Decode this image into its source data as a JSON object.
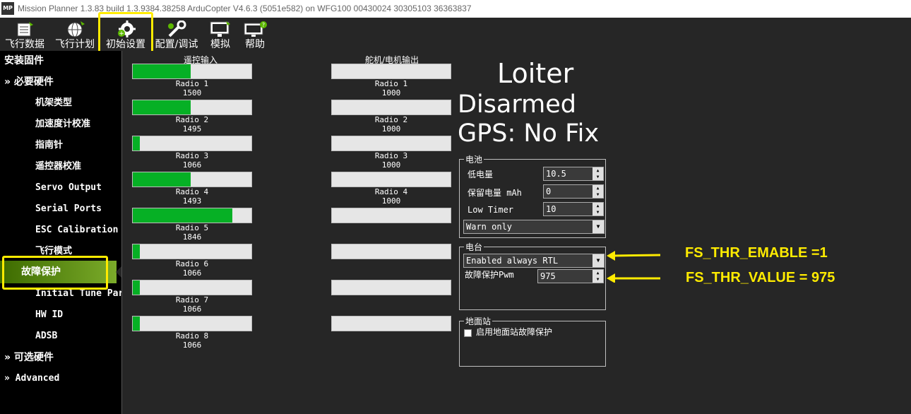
{
  "window": {
    "logo_text": "MP",
    "title": "Mission Planner 1.3.83 build 1.3.9384.38258 ArduCopter V4.6.3 (5051e582) on WFG100 00430024 30305103 36363837"
  },
  "toolbar": {
    "items": [
      {
        "label": "飞行数据",
        "icon": "flight-data-icon"
      },
      {
        "label": "飞行计划",
        "icon": "flight-plan-globe-icon"
      },
      {
        "label": "初始设置",
        "icon": "initial-setup-gear-icon"
      },
      {
        "label": "配置/调试",
        "icon": "config-tuning-wrench-icon"
      },
      {
        "label": "模拟",
        "icon": "simulation-monitor-icon"
      },
      {
        "label": "帮助",
        "icon": "help-monitor-icon"
      }
    ],
    "highlight_color": "#ffeb00"
  },
  "sidebar": {
    "items": [
      {
        "label": "安装固件"
      },
      {
        "label": "» 必要硬件"
      },
      {
        "label": "机架类型"
      },
      {
        "label": "加速度计校准"
      },
      {
        "label": "指南针"
      },
      {
        "label": "遥控器校准"
      },
      {
        "label": "Servo Output"
      },
      {
        "label": "Serial Ports"
      },
      {
        "label": "ESC Calibration"
      },
      {
        "label": "飞行模式"
      },
      {
        "label": "故障保护"
      },
      {
        "label": "Initial Tune Para"
      },
      {
        "label": "HW ID"
      },
      {
        "label": "ADSB"
      },
      {
        "label": "» 可选硬件"
      },
      {
        "label": "» Advanced"
      }
    ],
    "selected_color": "#7bab2a"
  },
  "rc_input": {
    "title": "遥控输入",
    "channels": [
      {
        "name": "Radio 1",
        "value": "1500",
        "fill": 0.49
      },
      {
        "name": "Radio 2",
        "value": "1495",
        "fill": 0.49
      },
      {
        "name": "Radio 3",
        "value": "1066",
        "fill": 0.06
      },
      {
        "name": "Radio 4",
        "value": "1493",
        "fill": 0.49
      },
      {
        "name": "Radio 5",
        "value": "1846",
        "fill": 0.84
      },
      {
        "name": "Radio 6",
        "value": "1066",
        "fill": 0.06
      },
      {
        "name": "Radio 7",
        "value": "1066",
        "fill": 0.06
      },
      {
        "name": "Radio 8",
        "value": "1066",
        "fill": 0.06
      }
    ]
  },
  "servo_output": {
    "title": "舵机/电机输出",
    "channels": [
      {
        "name": "Radio 1",
        "value": "1000",
        "fill": 0
      },
      {
        "name": "Radio 2",
        "value": "1000",
        "fill": 0
      },
      {
        "name": "Radio 3",
        "value": "1000",
        "fill": 0
      },
      {
        "name": "Radio 4",
        "value": "1000",
        "fill": 0
      },
      {
        "name": "",
        "value": "",
        "fill": 0
      },
      {
        "name": "",
        "value": "",
        "fill": 0
      },
      {
        "name": "",
        "value": "",
        "fill": 0
      },
      {
        "name": "",
        "value": "",
        "fill": 0
      }
    ]
  },
  "status": {
    "mode": "Loiter",
    "arm_state": "Disarmed",
    "gps": "GPS: No Fix"
  },
  "battery": {
    "legend": "电池",
    "low_voltage_label": "低电量",
    "low_voltage_value": "10.5",
    "reserved_mah_label": "保留电量 mAh",
    "reserved_mah_value": "0",
    "low_timer_label": "Low Timer",
    "low_timer_value": "10",
    "action": "Warn only"
  },
  "radio_failsafe": {
    "legend": "电台",
    "action": "Enabled always RTL",
    "pwm_label": "故障保护Pwm",
    "pwm_value": "975"
  },
  "gcs_failsafe": {
    "legend": "地面站",
    "checkbox_label": "启用地面站故障保护",
    "checked": false
  },
  "annotations": {
    "thr_enable": "FS_THR_EMABLE =1",
    "thr_value": "FS_THR_VALUE = 975",
    "color": "#ffeb00"
  }
}
